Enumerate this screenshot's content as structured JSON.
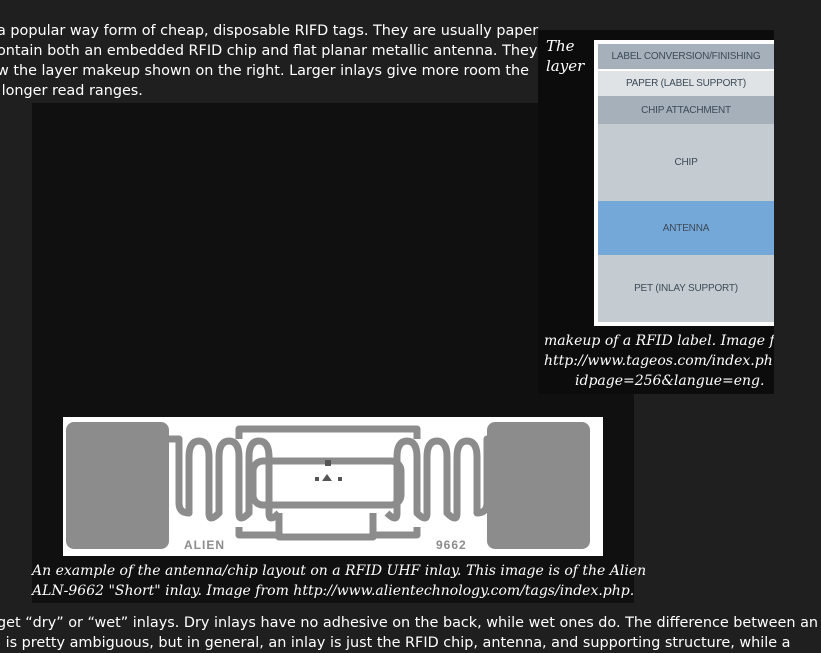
{
  "intro_lines": [
    "a popular way form of cheap, disposable RIFD tags. They are usually paper",
    "ontain both an embedded RFID chip and flat planar metallic antenna. They",
    "w the layer makeup shown on the right. Larger inlays give more room the",
    " longer read ranges."
  ],
  "layer_figure": {
    "caption_top": [
      "The",
      "layer"
    ],
    "caption_bottom": [
      "makeup of a RFID label. Image fro",
      "http://www.tageos.com/index.ph",
      "idpage=256&langue=eng."
    ],
    "layers": [
      {
        "label": "LABEL CONVERSION/FINISHING",
        "color": "#a5b0ba"
      },
      {
        "label": "PAPER (LABEL SUPPORT)",
        "color": "#dfe3e6"
      },
      {
        "label": "CHIP ATTACHMENT",
        "color": "#a5b0ba"
      },
      {
        "label": "CHIP",
        "color": "#c4ccd2"
      },
      {
        "label": "ANTENNA",
        "color": "#74a8d9"
      },
      {
        "label": "PET (INLAY SUPPORT)",
        "color": "#c4ccd2"
      }
    ]
  },
  "inlay_figure": {
    "brand_label": "ALIEN",
    "model_label": "9662",
    "caption": [
      "An example of the antenna/chip layout on a RFID UHF inlay. This image is of the Alien",
      "ALN-9662 \"Short\" inlay. Image from http://www.alientechnology.com/tags/index.php."
    ]
  },
  "bottom_lines": [
    "get “dry” or “wet” inlays. Dry inlays have no adhesive on the back, while wet ones do. The difference between an",
    "l is pretty ambiguous, but in general, an inlay is just the RFID chip, antenna, and supporting structure, while a"
  ]
}
